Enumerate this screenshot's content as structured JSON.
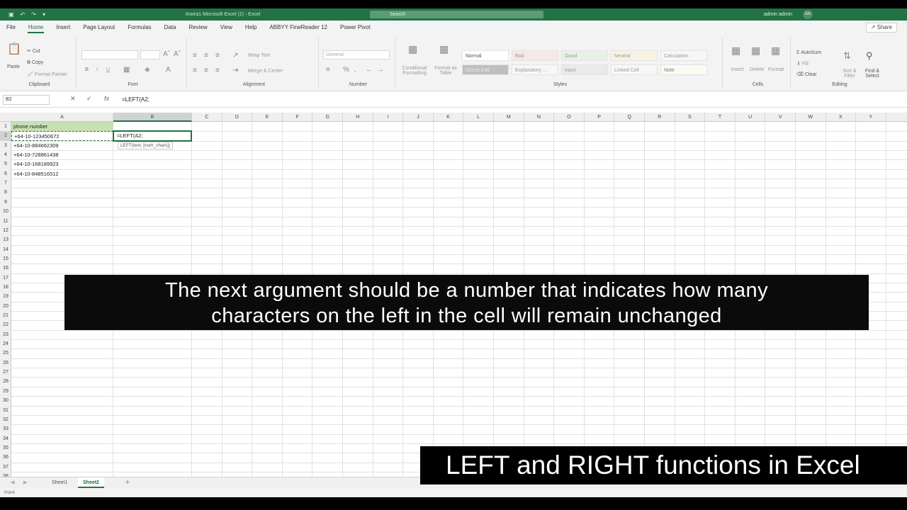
{
  "titlebar": {
    "window_title": "Книга1 Microsoft Excel (2) - Excel",
    "search_placeholder": "Search",
    "user_name": "admin admin",
    "avatar_initials": "AA"
  },
  "menu": {
    "tabs": [
      "File",
      "Home",
      "Insert",
      "Page Layout",
      "Formulas",
      "Data",
      "Review",
      "View",
      "Help",
      "ABBYY FineReader 12",
      "Power Pivot"
    ],
    "active_tab": "Home",
    "share_label": "Share"
  },
  "ribbon": {
    "clipboard": {
      "paste": "Paste",
      "cut": "Cut",
      "copy": "Copy",
      "format_painter": "Format Painter",
      "group": "Clipboard"
    },
    "font": {
      "group": "Font",
      "bold": "B",
      "italic": "I",
      "underline": "U"
    },
    "alignment": {
      "wrap": "Wrap Text",
      "merge": "Merge & Center",
      "group": "Alignment"
    },
    "number": {
      "format": "General",
      "group": "Number"
    },
    "styles": {
      "conditional": "Conditional Formatting",
      "format_table": "Format as Table",
      "cells": [
        "Normal",
        "Bad",
        "Good",
        "Neutral",
        "Calculation",
        "Check Cell",
        "Explanatory ...",
        "Input",
        "Linked Cell",
        "Note"
      ],
      "group": "Styles"
    },
    "cells": {
      "insert": "Insert",
      "delete": "Delete",
      "format": "Format",
      "group": "Cells"
    },
    "editing": {
      "autosum": "AutoSum",
      "fill": "Fill",
      "clear": "Clear",
      "sort": "Sort & Filter",
      "find": "Find & Select",
      "group": "Editing"
    }
  },
  "formula_bar": {
    "name_box": "B2",
    "formula": "=LEFT(A2;"
  },
  "sheet": {
    "columns": [
      "A",
      "B",
      "C",
      "D",
      "E",
      "F",
      "G",
      "H",
      "I",
      "J",
      "K",
      "L",
      "M",
      "N",
      "O",
      "P",
      "Q",
      "R",
      "S",
      "T",
      "U",
      "V",
      "W",
      "X",
      "Y"
    ],
    "rows": [
      "1",
      "2",
      "3",
      "4",
      "5",
      "6",
      "7",
      "8",
      "9",
      "10",
      "11",
      "12",
      "13",
      "14",
      "15",
      "16",
      "17",
      "18",
      "19",
      "20",
      "21",
      "22",
      "23",
      "24",
      "25",
      "26",
      "27",
      "28",
      "29",
      "30",
      "31",
      "32",
      "33",
      "34",
      "35",
      "36",
      "37",
      "38"
    ],
    "header_a1": "phone number",
    "column_a": [
      "+64-10-123450672",
      "+64-10-884662309",
      "+64-10-728861438",
      "+64-10-168189923",
      "+64-10-848516512"
    ],
    "editing_cell": "=LEFT(A2;",
    "tooltip": "LEFT(text; [num_chars])"
  },
  "sheet_tabs": {
    "tabs": [
      "Sheet1",
      "Sheet2"
    ],
    "active": "Sheet2",
    "add": "+"
  },
  "status": {
    "left": "Point"
  },
  "overlay": {
    "caption_line1": "The next argument should be a number that indicates how many",
    "caption_line2": "characters on the left in the cell will remain unchanged",
    "video_title": "LEFT and RIGHT functions in Excel"
  }
}
